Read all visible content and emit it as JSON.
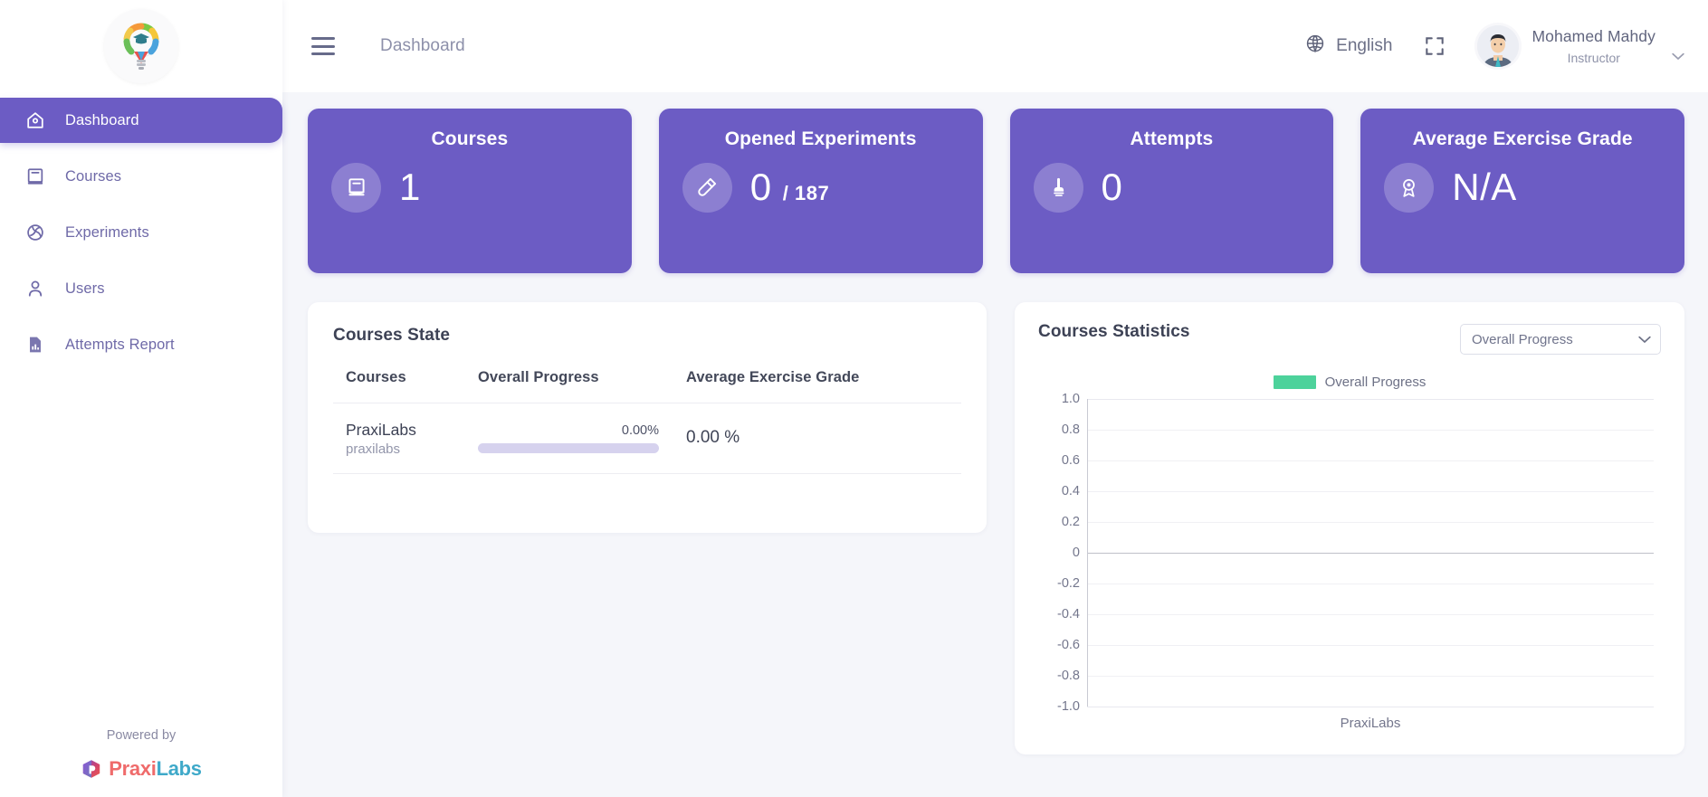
{
  "sidebar": {
    "brand_icon": "lightbulb-graduation-logo",
    "items": [
      {
        "label": "Dashboard",
        "icon": "home-icon",
        "active": true
      },
      {
        "label": "Courses",
        "icon": "book-icon",
        "active": false
      },
      {
        "label": "Experiments",
        "icon": "flask-circle-icon",
        "active": false
      },
      {
        "label": "Users",
        "icon": "user-icon",
        "active": false
      },
      {
        "label": "Attempts Report",
        "icon": "file-chart-icon",
        "active": false
      }
    ],
    "powered_by": "Powered by",
    "logo_text_a": "Praxi",
    "logo_text_b": "Labs"
  },
  "topbar": {
    "menu_icon": "hamburger-icon",
    "breadcrumb": "Dashboard",
    "language": "English",
    "language_icon": "globe-icon",
    "fullscreen_icon": "fullscreen-icon",
    "user_name": "Mohamed Mahdy",
    "user_role": "Instructor",
    "caret_icon": "chevron-down-icon"
  },
  "cards": [
    {
      "title": "Courses",
      "value": "1",
      "suffix": "",
      "icon": "book-icon"
    },
    {
      "title": "Opened Experiments",
      "value": "0",
      "suffix": "/ 187",
      "icon": "test-tube-icon"
    },
    {
      "title": "Attempts",
      "value": "0",
      "suffix": "",
      "icon": "hand-pointer-icon"
    },
    {
      "title": "Average Exercise Grade",
      "value": "N/A",
      "suffix": "",
      "icon": "award-badge-icon"
    }
  ],
  "courses_state": {
    "title": "Courses State",
    "columns": [
      "Courses",
      "Overall Progress",
      "Average Exercise Grade"
    ],
    "rows": [
      {
        "course": "PraxiLabs",
        "slug": "praxilabs",
        "progress_label": "0.00%",
        "progress_value": 0,
        "avg_grade": "0.00 %"
      }
    ]
  },
  "courses_statistics": {
    "title": "Courses Statistics",
    "selected_metric": "Overall Progress",
    "metric_options": [
      "Overall Progress"
    ]
  },
  "chart_data": {
    "type": "bar",
    "title": "Courses Statistics",
    "xlabel": "",
    "ylabel": "",
    "categories": [
      "PraxiLabs"
    ],
    "series": [
      {
        "name": "Overall Progress",
        "values": [
          0
        ],
        "color": "#4dd29b"
      }
    ],
    "ylim": [
      -1.0,
      1.0
    ],
    "yticks": [
      "1.0",
      "0.8",
      "0.6",
      "0.4",
      "0.2",
      "0",
      "-0.2",
      "-0.4",
      "-0.6",
      "-0.8",
      "-1.0"
    ],
    "grid": true,
    "legend": "top-center",
    "legend_entries": [
      "Overall Progress"
    ]
  },
  "colors": {
    "accent": "#6c5cc4",
    "sidebar_bg": "#ffffff",
    "page_bg": "#f5f6fa",
    "series_green": "#4dd29b",
    "progress_track": "#d6d2ee",
    "logo_coral": "#ef6b6b",
    "logo_teal": "#3fa9c9"
  }
}
